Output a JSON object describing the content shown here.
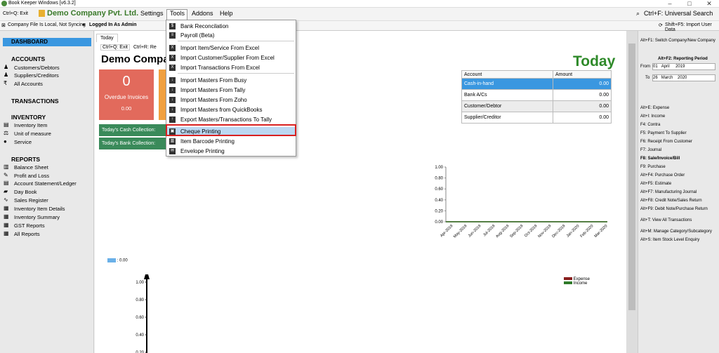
{
  "window": {
    "title": "Book Keeper Windows [v6.3.2]"
  },
  "menubar": {
    "exit_shortcut": "Ctrl+Q: Exit",
    "company": "Demo Company Pvt. Ltd.",
    "items": [
      "Settings",
      "Tools",
      "Addons",
      "Help"
    ],
    "search": "Ctrl+F: Universal Search"
  },
  "status": {
    "file": "Company File Is Local, Not Syncing",
    "user": "Logged In As Admin",
    "import_user": "Shift+F5: Import User Data"
  },
  "sidebar": {
    "dashboard": "DASHBOARD",
    "accounts_header": "ACCOUNTS",
    "accounts": [
      "Customers/Debtors",
      "Suppliers/Creditors",
      "All Accounts"
    ],
    "transactions_header": "TRANSACTIONS",
    "inventory_header": "INVENTORY",
    "inventory": [
      "Inventory Item",
      "Unit of measure",
      "Service"
    ],
    "reports_header": "REPORTS",
    "reports": [
      "Balance Sheet",
      "Profit and Loss",
      "Account Statement/Ledger",
      "Day Book",
      "Sales Register",
      "Inventory Item Details",
      "Inventory Summary",
      "GST Reports",
      "All Reports"
    ]
  },
  "main": {
    "tab": "Today",
    "exit": "Ctrl+Q: Exit",
    "refresh": "Ctrl+R: Re",
    "title": "Demo Compa",
    "today_big": "Today",
    "overdue_count": "0",
    "overdue_label": "Overdue Invoices",
    "overdue_amount": "0.00",
    "cash_collection": "Today's Cash Collection:",
    "bank_collection": "Today's Bank Collection:",
    "table_headers": [
      "Account",
      "Amount"
    ],
    "table_rows": [
      {
        "account": "Cash-in-hand",
        "amount": "0.00"
      },
      {
        "account": "Bank A/Cs",
        "amount": "0.00"
      },
      {
        "account": "Customer/Debtor",
        "amount": "0.00"
      },
      {
        "account": "Supplier/Creditor",
        "amount": "0.00"
      }
    ]
  },
  "menu": {
    "items": [
      "Bank Reconcilation",
      "Payroll (Beta)",
      "Import Item/Service From Excel",
      "Import Customer/Supplier From Excel",
      "Import Transactions From Excel",
      "Import Masters From Busy",
      "Import Masters From Tally",
      "Import Masters From Zoho",
      "Import Masters from QuickBooks",
      "Export Masters/Transactions To Tally",
      "Cheque Printing",
      "Item Barcode Printing",
      "Envelope Printing"
    ],
    "selected": "Cheque Printing"
  },
  "right_panel": {
    "switch": "Alt+F1: Switch Company/New Company",
    "period_title": "Alt+F2: Reporting Period",
    "from_label": "From",
    "from_day": "01",
    "from_month": "April",
    "from_year": "2019",
    "to_label": "To",
    "to_day": "26",
    "to_month": "March",
    "to_year": "2020",
    "shortcuts": [
      "Alt+E: Expense",
      "Alt+I: Income",
      "F4: Contra",
      "F5: Payment To Supplier",
      "F6: Receipt From Customer",
      "F7: Journal",
      "F8: Sale/Invoice/Bill",
      "F9: Purchase",
      "Alt+F4: Purchase Order",
      "Alt+F5: Estimate",
      "Alt+F7: Manufacturing Journal",
      "Alt+F8: Credit Note/Sales Return",
      "Alt+F9: Debit Note/Purchase Return",
      "Alt+T: View All Transactions",
      "Alt+M: Manage Category/Subcategory",
      "Alt+S: Item Stock Level Enquiry"
    ]
  },
  "chart_data": [
    {
      "type": "line",
      "categories": [
        "Apr-2019",
        "May-2019",
        "Jun-2019",
        "Jul-2019",
        "Aug-2019",
        "Sep-2019",
        "Oct-2019",
        "Nov-2019",
        "Dec-2019",
        "Jan-2020",
        "Feb-2020",
        "Mar-2020"
      ],
      "series": [
        {
          "name": "Expense",
          "values": [
            0,
            0,
            0,
            0,
            0,
            0,
            0,
            0,
            0,
            0,
            0,
            0
          ],
          "color": "#8a1f1f"
        },
        {
          "name": "Income",
          "values": [
            0,
            0,
            0,
            0,
            0,
            0,
            0,
            0,
            0,
            0,
            0,
            0
          ],
          "color": "#2f7a2a"
        }
      ],
      "yticks": [
        "1.00",
        "0.80",
        "0.60",
        "0.40",
        "0.20",
        "0.00"
      ],
      "ylim": [
        0,
        1
      ]
    },
    {
      "type": "bar",
      "legend": ": 0.00",
      "yticks": [
        "1.00",
        "0.80",
        "0.60",
        "0.40",
        "0.20"
      ]
    }
  ],
  "colors": {
    "accent": "#3a97e0",
    "brand": "#2f8a2a",
    "overdue": "#e26a5c",
    "highlight_box": "#d82020"
  }
}
